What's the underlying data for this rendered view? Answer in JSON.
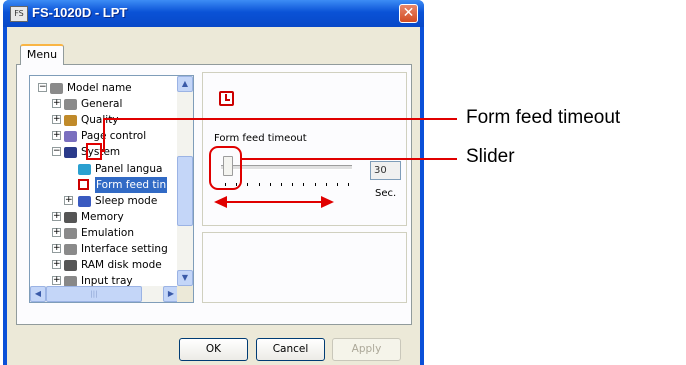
{
  "window": {
    "title": "FS-1020D - LPT",
    "app_icon_text": "FS"
  },
  "tab": {
    "label": "Menu"
  },
  "tree": {
    "items": [
      {
        "label": "Model name",
        "depth": 0,
        "expander": "−",
        "icon": "printer-icon"
      },
      {
        "label": "General",
        "depth": 1,
        "expander": "+",
        "icon": "printer-icon"
      },
      {
        "label": "Quality",
        "depth": 1,
        "expander": "+",
        "icon": "quality-icon"
      },
      {
        "label": "Page control",
        "depth": 1,
        "expander": "+",
        "icon": "page-icon"
      },
      {
        "label": "System",
        "depth": 1,
        "expander": "−",
        "icon": "floppy-icon"
      },
      {
        "label": "Panel langua",
        "depth": 2,
        "expander": "",
        "icon": "flag-icon"
      },
      {
        "label": "Form feed tin",
        "depth": 2,
        "expander": "",
        "icon": "clock-icon",
        "selected": true
      },
      {
        "label": "Sleep mode",
        "depth": 2,
        "expander": "+",
        "icon": "sleep-icon"
      },
      {
        "label": "Memory",
        "depth": 1,
        "expander": "+",
        "icon": "memory-icon"
      },
      {
        "label": "Emulation",
        "depth": 1,
        "expander": "+",
        "icon": "printer-icon"
      },
      {
        "label": "Interface setting",
        "depth": 1,
        "expander": "+",
        "icon": "printer-icon"
      },
      {
        "label": "RAM disk mode",
        "depth": 1,
        "expander": "+",
        "icon": "memory-icon"
      },
      {
        "label": "Input tray",
        "depth": 1,
        "expander": "+",
        "icon": "tray-icon"
      }
    ],
    "scroll_up": "▲",
    "scroll_down": "▼",
    "scroll_left": "◀",
    "scroll_right": "▶"
  },
  "settings": {
    "label": "Form feed timeout",
    "value": "30",
    "unit": "Sec.",
    "slider_level": 0.06
  },
  "buttons": {
    "ok": "OK",
    "cancel": "Cancel",
    "apply": "Apply"
  },
  "annotations": {
    "form_feed_timeout": "Form feed timeout",
    "slider": "Slider"
  },
  "colors": {
    "title_bar": "#0a52d6",
    "annotation_red": "#e00000",
    "selection": "#316ac5"
  }
}
